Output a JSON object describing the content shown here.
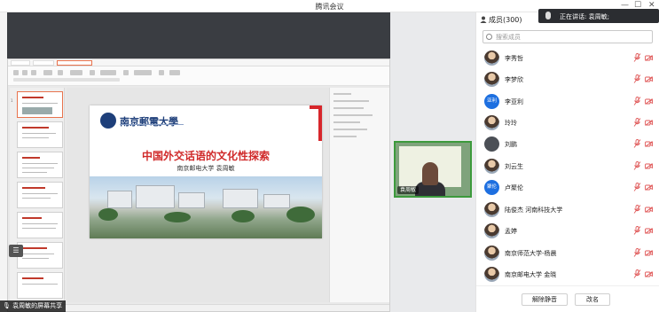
{
  "window": {
    "title": "腾讯会议",
    "controls": [
      "—",
      "☐",
      "✕"
    ]
  },
  "share": {
    "presenter_label": "袁周敏的屏幕共享",
    "camera_label": "袁周敏"
  },
  "slide": {
    "university_logo_text": "南京郵電大學",
    "title": "中国外交话语的文化性探索",
    "byline": "南京邮电大学  袁周敏"
  },
  "members_panel": {
    "count_label": "成员(300)",
    "speaking_banner": "正在讲话: 袁周敏;",
    "search_placeholder": "搜索成员",
    "members": [
      {
        "name": "李秀哲",
        "avatar": "photo"
      },
      {
        "name": "李梦欣",
        "avatar": "photo"
      },
      {
        "name": "李亚利",
        "avatar": "blue",
        "avatar_text": "亚利"
      },
      {
        "name": "玲玲",
        "avatar": "photo"
      },
      {
        "name": "刘鹏",
        "avatar": "dark"
      },
      {
        "name": "刘云生",
        "avatar": "photo"
      },
      {
        "name": "卢聚伦",
        "avatar": "blue",
        "avatar_text": "聚伦"
      },
      {
        "name": "陆俊杰 河南科技大学",
        "avatar": "photo"
      },
      {
        "name": "孟婷",
        "avatar": "photo"
      },
      {
        "name": "南京师范大学-杨晨",
        "avatar": "photo"
      },
      {
        "name": "南京邮电大学 金晓",
        "avatar": "photo"
      }
    ],
    "unmute_all_label": "解除静音",
    "rename_label": "改名"
  },
  "colors": {
    "accent_red": "#d7262b",
    "avatar_blue": "#1d6fe0",
    "camera_border_green": "#3c9a3c"
  }
}
